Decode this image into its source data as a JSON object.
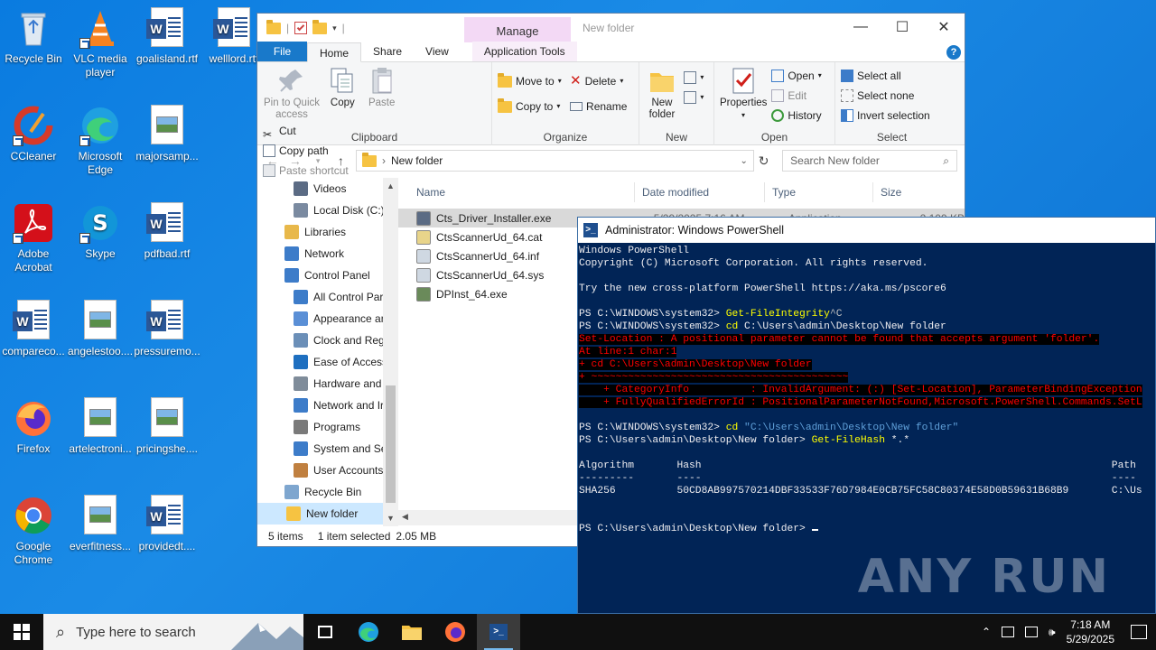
{
  "desktop": {
    "icons": [
      {
        "label": "Recycle Bin"
      },
      {
        "label": "VLC media player"
      },
      {
        "label": "goalisland.rtf"
      },
      {
        "label": "welllord.rtf"
      },
      {
        "label": "CCleaner"
      },
      {
        "label": "Microsoft Edge"
      },
      {
        "label": "majorsamp..."
      },
      {
        "label": "Adobe Acrobat"
      },
      {
        "label": "Skype"
      },
      {
        "label": "pdfbad.rtf"
      },
      {
        "label": "compareco..."
      },
      {
        "label": "angelestoo...."
      },
      {
        "label": "pressuremo..."
      },
      {
        "label": "Firefox"
      },
      {
        "label": "artelectroni..."
      },
      {
        "label": "pricingshe...."
      },
      {
        "label": "Google Chrome"
      },
      {
        "label": "everfitness..."
      },
      {
        "label": "providedt...."
      }
    ]
  },
  "explorer": {
    "title": "New folder",
    "manage_tab": "Manage",
    "tabs": {
      "file": "File",
      "home": "Home",
      "share": "Share",
      "view": "View",
      "app_tools": "Application Tools"
    },
    "clipboard": {
      "pin": "Pin to Quick access",
      "copy": "Copy",
      "paste": "Paste",
      "cut": "Cut",
      "copy_path": "Copy path",
      "paste_shortcut": "Paste shortcut",
      "label": "Clipboard"
    },
    "organize": {
      "move_to": "Move to",
      "copy_to": "Copy to",
      "delete": "Delete",
      "rename": "Rename",
      "label": "Organize"
    },
    "new": {
      "new_folder": "New folder",
      "label": "New"
    },
    "open": {
      "properties": "Properties",
      "open": "Open",
      "edit": "Edit",
      "history": "History",
      "label": "Open"
    },
    "select": {
      "select_all": "Select all",
      "select_none": "Select none",
      "invert": "Invert selection",
      "label": "Select"
    },
    "address": "New folder",
    "search_placeholder": "Search New folder",
    "nav": [
      {
        "label": "Videos",
        "color": "#5b6b84"
      },
      {
        "label": "Local Disk (C:)",
        "color": "#7a8aa0"
      },
      {
        "label": "Libraries",
        "color": "#e8b84a"
      },
      {
        "label": "Network",
        "color": "#3d7cc9"
      },
      {
        "label": "Control Panel",
        "color": "#3d7cc9"
      },
      {
        "label": "All Control Par",
        "color": "#3d7cc9"
      },
      {
        "label": "Appearance an",
        "color": "#5a8fd6"
      },
      {
        "label": "Clock and Regi",
        "color": "#6b8fb8"
      },
      {
        "label": "Ease of Access",
        "color": "#1e6fc0"
      },
      {
        "label": "Hardware and",
        "color": "#7f8c9a"
      },
      {
        "label": "Network and Ir",
        "color": "#3d7cc9"
      },
      {
        "label": "Programs",
        "color": "#7a7a7a"
      },
      {
        "label": "System and Se",
        "color": "#3d7cc9"
      },
      {
        "label": "User Accounts",
        "color": "#c08040"
      },
      {
        "label": "Recycle Bin",
        "color": "#7ea6cf"
      },
      {
        "label": "New folder",
        "color": "#f6c342"
      }
    ],
    "columns": {
      "name": "Name",
      "date": "Date modified",
      "type": "Type",
      "size": "Size"
    },
    "files": [
      {
        "name": "Cts_Driver_Installer.exe",
        "date": "5/29/2025 7:16 AM",
        "type": "Application",
        "size": "2,109 KB"
      },
      {
        "name": "CtsScannerUd_64.cat"
      },
      {
        "name": "CtsScannerUd_64.inf"
      },
      {
        "name": "CtsScannerUd_64.sys"
      },
      {
        "name": "DPInst_64.exe"
      }
    ],
    "status": {
      "items": "5 items",
      "selected": "1 item selected",
      "size": "2.05 MB"
    }
  },
  "powershell": {
    "title": "Administrator: Windows PowerShell",
    "lines": {
      "l1": "Windows PowerShell",
      "l2": "Copyright (C) Microsoft Corporation. All rights reserved.",
      "l3": "Try the new cross-platform PowerShell https://aka.ms/pscore6",
      "p1": "PS C:\\WINDOWS\\system32> ",
      "c1": "Get-FileIntegrity",
      "c1b": "^C",
      "c2": "cd",
      "c2b": " C:\\Users\\admin\\Desktop\\New folder",
      "e1": "Set-Location : A positional parameter cannot be found that accepts argument 'folder'.",
      "e2": "At line:1 char:1",
      "e3": "+ cd C:\\Users\\admin\\Desktop\\New folder",
      "e4": "+ ~~~~~~~~~~~~~~~~~~~~~~~~~~~~~~~~~~~~~~~~~~",
      "e5": "    + CategoryInfo          : InvalidArgument: (:) [Set-Location], ParameterBindingException",
      "e6": "    + FullyQualifiedErrorId : PositionalParameterNotFound,Microsoft.PowerShell.Commands.SetL",
      "c3": "cd",
      "c3b": " \"C:\\Users\\admin\\Desktop\\New folder\"",
      "p2": "PS C:\\Users\\admin\\Desktop\\New folder> ",
      "c4": "Get-FileHash",
      "c4b": " *.*",
      "h1": "Algorithm       Hash                                                                   Path",
      "h2": "---------       ----                                                                   ----",
      "h3": "SHA256          50CD8AB997570214DBF33533F76D7984E0CB75FC58C80374E58D0B59631B68B9       C:\\Us"
    }
  },
  "watermark": "ANY RUN",
  "taskbar": {
    "search_placeholder": "Type here to search",
    "time": "7:18 AM",
    "date": "5/29/2025"
  },
  "colors": {
    "accent": "#1979ca",
    "ps_bg": "#012456",
    "error": "#ff0000",
    "command": "#ffff00"
  }
}
